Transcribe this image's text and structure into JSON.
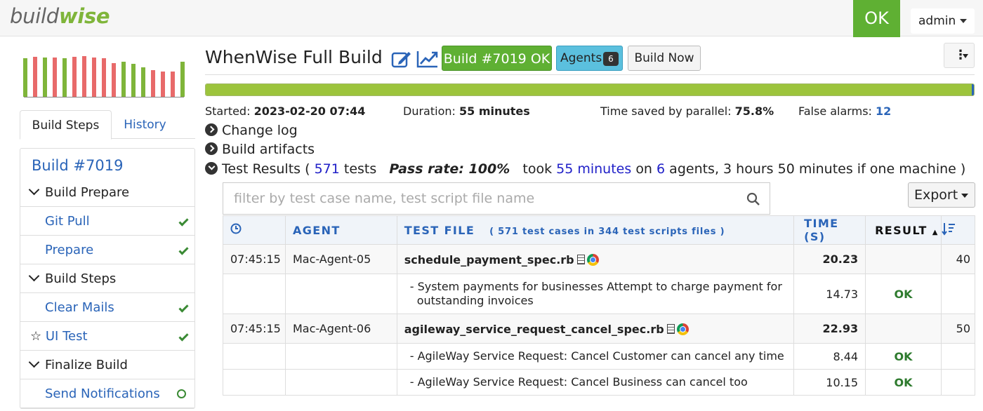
{
  "app": {
    "logo_pre": "build",
    "logo_bold": "wise",
    "status": "OK",
    "user": "admin"
  },
  "mini_chart": {
    "type": "bar",
    "bars": [
      {
        "h": 0.88,
        "color": "#7fb53a"
      },
      {
        "h": 0.92,
        "color": "#e86a6a"
      },
      {
        "h": 0.9,
        "color": "#7fb53a"
      },
      {
        "h": 0.9,
        "color": "#e86a6a"
      },
      {
        "h": 0.88,
        "color": "#7fb53a"
      },
      {
        "h": 0.92,
        "color": "#e86a6a"
      },
      {
        "h": 0.93,
        "color": "#e86a6a"
      },
      {
        "h": 0.9,
        "color": "#e86a6a"
      },
      {
        "h": 0.88,
        "color": "#e86a6a"
      },
      {
        "h": 0.78,
        "color": "#e86a6a"
      },
      {
        "h": 0.8,
        "color": "#7fb53a"
      },
      {
        "h": 0.75,
        "color": "#7fb53a"
      },
      {
        "h": 0.68,
        "color": "#7fb53a"
      },
      {
        "h": 0.62,
        "color": "#e86a6a"
      },
      {
        "h": 0.58,
        "color": "#e86a6a"
      },
      {
        "h": 0.58,
        "color": "#e86a6a"
      },
      {
        "h": 0.8,
        "color": "#7fb53a"
      }
    ]
  },
  "tabs": [
    "Build Steps",
    "History"
  ],
  "steps": {
    "title": "Build #7019",
    "items": [
      {
        "label": "Build Prepare",
        "kind": "head",
        "status": ""
      },
      {
        "label": "Git Pull",
        "kind": "link",
        "status": "done"
      },
      {
        "label": "Prepare",
        "kind": "link",
        "status": "done"
      },
      {
        "label": "Build Steps",
        "kind": "head",
        "status": ""
      },
      {
        "label": "Clear Mails",
        "kind": "link",
        "status": "done"
      },
      {
        "label": "UI Test",
        "kind": "link-star",
        "status": "done"
      },
      {
        "label": "Finalize Build",
        "kind": "head",
        "status": ""
      },
      {
        "label": "Send Notifications",
        "kind": "link",
        "status": "pending"
      }
    ]
  },
  "header": {
    "title": "WhenWise Full Build",
    "build_badge": "Build #7019 OK",
    "agents_label": "Agents",
    "agents_count": "6",
    "build_now": "Build Now",
    "progress": 1.0
  },
  "meta": {
    "started_label": "Started:",
    "started": "2023-02-20 07:44",
    "duration_label": "Duration:",
    "duration": "55 minutes",
    "saved_label": "Time saved by parallel:",
    "saved": "75.8%",
    "alarms_label": "False alarms:",
    "alarms": "12"
  },
  "sections": {
    "changelog": "Change log",
    "artifacts": "Build artifacts",
    "results_pre": "Test Results (",
    "tests_count": "571",
    "tests_word": "tests",
    "pass_label": "Pass rate:",
    "pass_rate": "100%",
    "took": "took",
    "took_time": "55 minutes",
    "on": "on",
    "agent_count": "6",
    "results_post": "agents, 3 hours 50 minutes if one machine )"
  },
  "filter": {
    "placeholder": "filter by test case name, test script file name"
  },
  "export_label": "Export",
  "table": {
    "headers": {
      "agent": "AGENT",
      "file": "TEST FILE",
      "file_sub_open": "( 571",
      "file_sub_mid1": "test cases in",
      "file_sub_num2": "344",
      "file_sub_mid2": "test scripts files )",
      "duration": "TIME (S)",
      "result": "RESULT"
    },
    "rows": [
      {
        "type": "file",
        "time": "07:45:15",
        "agent": "Mac-Agent-05",
        "name": "schedule_payment_spec.rb",
        "duration": "20.23",
        "result": "",
        "order": "40"
      },
      {
        "type": "case",
        "time": "",
        "agent": "",
        "name": "- System payments for businesses Attempt to charge payment for outstanding invoices",
        "duration": "14.73",
        "result": "OK",
        "order": ""
      },
      {
        "type": "file",
        "time": "07:45:15",
        "agent": "Mac-Agent-06",
        "name": "agileway_service_request_cancel_spec.rb",
        "duration": "22.93",
        "result": "",
        "order": "50"
      },
      {
        "type": "case",
        "time": "",
        "agent": "",
        "name": "- AgileWay Service Request: Cancel Customer can cancel any time",
        "duration": "8.44",
        "result": "OK",
        "order": ""
      },
      {
        "type": "case",
        "time": "",
        "agent": "",
        "name": "- AgileWay Service Request: Cancel Business can cancel too",
        "duration": "10.15",
        "result": "OK",
        "order": ""
      }
    ]
  }
}
